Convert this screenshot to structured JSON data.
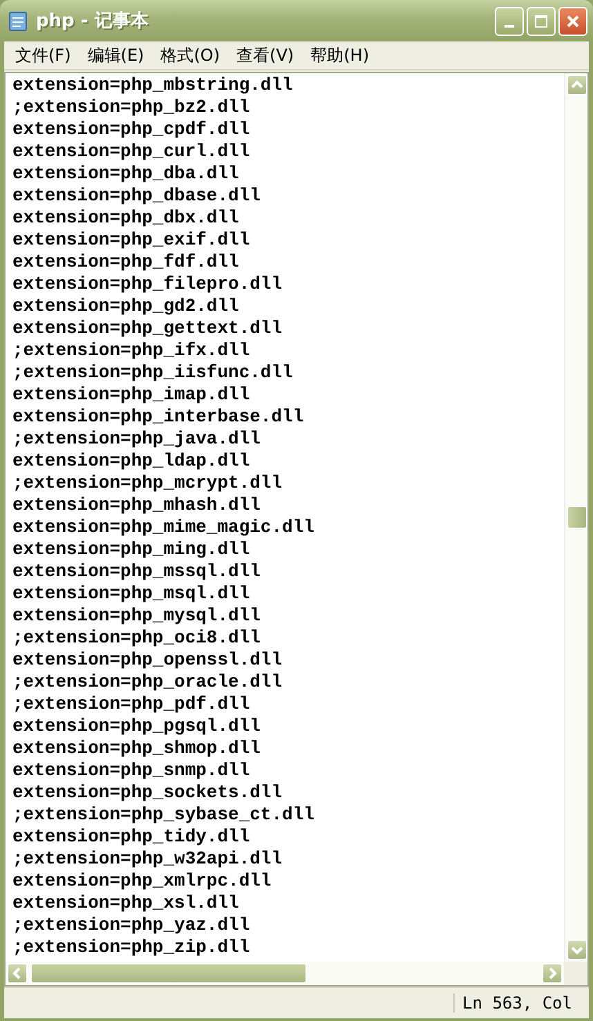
{
  "window": {
    "title": "php - 记事本"
  },
  "menu": [
    "文件(F)",
    "编辑(E)",
    "格式(O)",
    "查看(V)",
    "帮助(H)"
  ],
  "editor": {
    "lines": [
      "extension=php_mbstring.dll",
      ";extension=php_bz2.dll",
      "extension=php_cpdf.dll",
      "extension=php_curl.dll",
      "extension=php_dba.dll",
      "extension=php_dbase.dll",
      "extension=php_dbx.dll",
      "extension=php_exif.dll",
      "extension=php_fdf.dll",
      "extension=php_filepro.dll",
      "extension=php_gd2.dll",
      "extension=php_gettext.dll",
      ";extension=php_ifx.dll",
      ";extension=php_iisfunc.dll",
      "extension=php_imap.dll",
      "extension=php_interbase.dll",
      ";extension=php_java.dll",
      "extension=php_ldap.dll",
      ";extension=php_mcrypt.dll",
      "extension=php_mhash.dll",
      "extension=php_mime_magic.dll",
      "extension=php_ming.dll",
      "extension=php_mssql.dll",
      "extension=php_msql.dll",
      "extension=php_mysql.dll",
      ";extension=php_oci8.dll",
      "extension=php_openssl.dll",
      ";extension=php_oracle.dll",
      ";extension=php_pdf.dll",
      "extension=php_pgsql.dll",
      "extension=php_shmop.dll",
      "extension=php_snmp.dll",
      "extension=php_sockets.dll",
      ";extension=php_sybase_ct.dll",
      "extension=php_tidy.dll",
      ";extension=php_w32api.dll",
      "extension=php_xmlrpc.dll",
      "extension=php_xsl.dll",
      ";extension=php_yaz.dll",
      ";extension=php_zip.dll"
    ]
  },
  "status_bar": {
    "position": "Ln 563, Col"
  }
}
